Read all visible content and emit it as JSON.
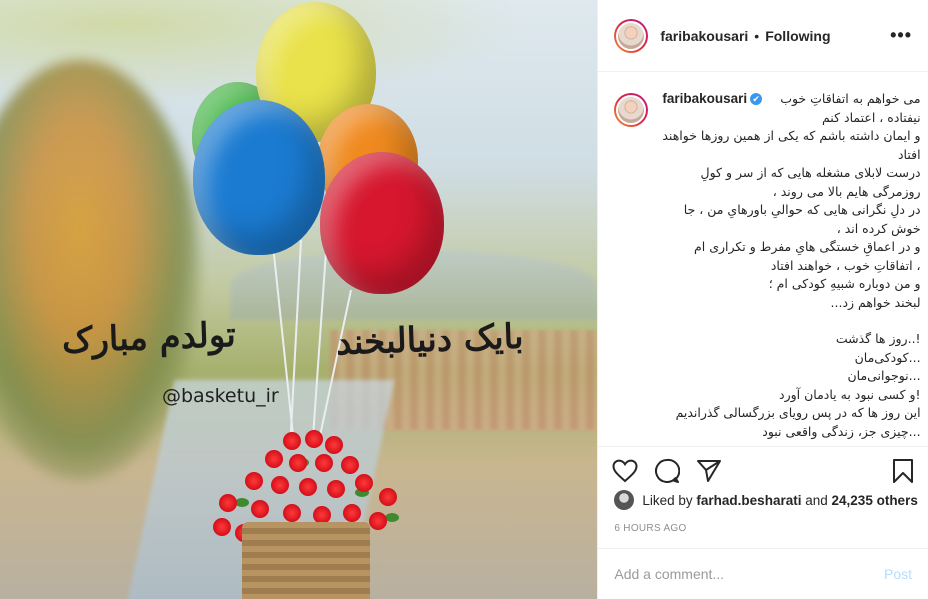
{
  "header": {
    "username": "faribakousari",
    "separator": "•",
    "follow_status": "Following",
    "more_label": "•••"
  },
  "caption": {
    "username": "faribakousari",
    "verified_glyph": "✔",
    "lines": [
      "می خواهم به اتفاقاتِ خوب",
      "نیفتاده ، اعتماد کنم",
      "و ایمان داشته باشم که یکی از همین روزها خواهند",
      "افتاد",
      "درست لابلای مشغله هایی که از سر و کولِ",
      "روزمرگی هایم بالا می روند ،",
      "در دلِ نگرانی هایی که حوالیِ باورهایِ من ، جا",
      "خوش کرده اند ،",
      "و در اعماقِ خستگی هایِ مفرط و تکراری ام",
      "، اتفاقاتِ خوب ، خواهند افتاد",
      "و من دوباره شبیهِ کودکی ام ؛",
      "لبخند خواهم زد..."
    ],
    "lines2": [
      "!..روز ها گذشت",
      "...کودکی‌مان",
      "...نوجوانی‌مان",
      "!و کسی نبود به یادمان آورد",
      "این روز ها که در پس رویای بزرگسالی گذراندیم",
      "...چیزی جز، زندگی واقعی نبود"
    ]
  },
  "image": {
    "calligraphy_right": "تولدم مبارک",
    "calligraphy_left": "بایک دنیالبخند",
    "handle": "@basketu_ir"
  },
  "likes": {
    "prefix": "Liked by",
    "user": "farhad.besharati",
    "joiner": "and",
    "others": "24,235 others"
  },
  "timestamp": "6 HOURS AGO",
  "comment_box": {
    "placeholder": "Add a comment...",
    "post_label": "Post"
  },
  "colors": {
    "verified": "#3897f0",
    "post_disabled": "#b2dffc",
    "story_ring": "#dc2743"
  }
}
